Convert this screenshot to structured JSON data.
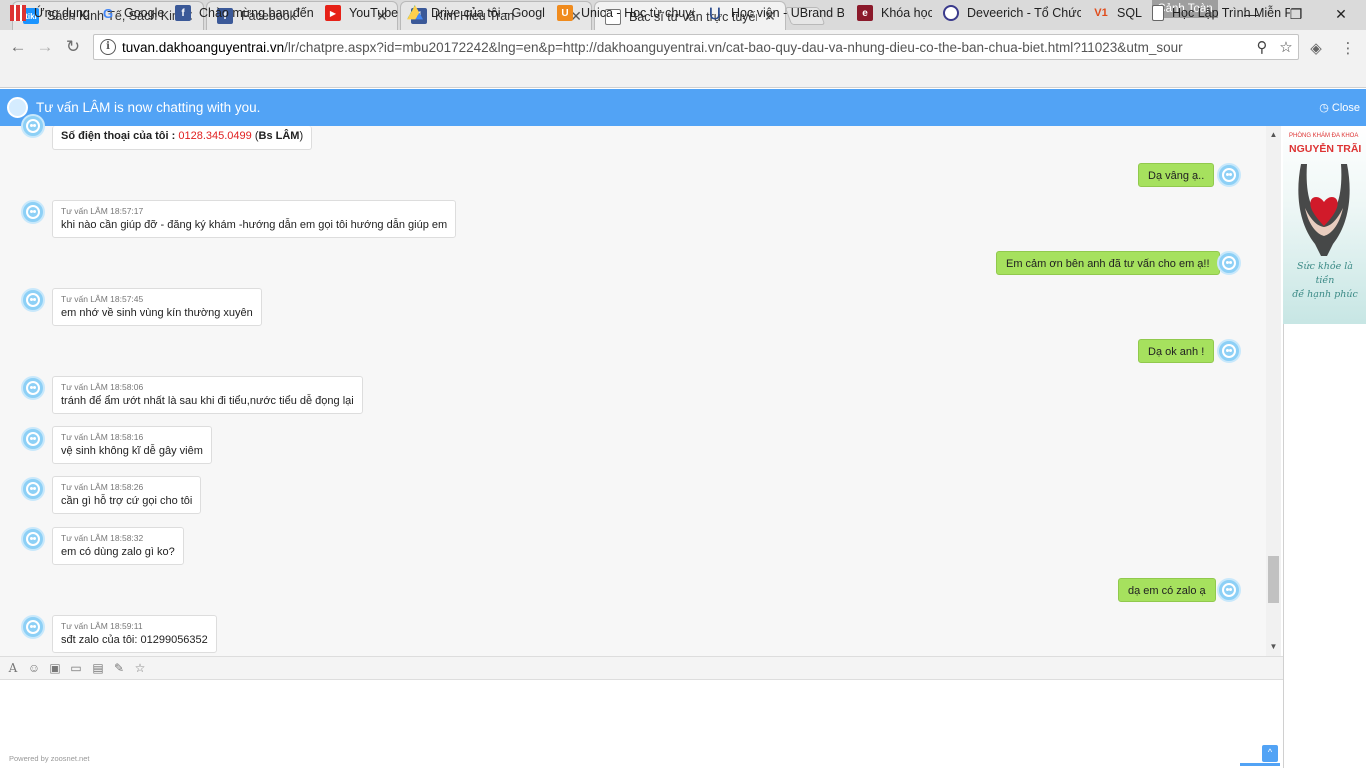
{
  "tabs": [
    {
      "title": "Sách Kinh Tế, Sách Kinh Doanh",
      "favicon": "tiki-icon",
      "color": "#1a94ff"
    },
    {
      "title": "Facebook",
      "favicon": "facebook-icon",
      "color": "#3b5998"
    },
    {
      "title": "Kim Hieu Tran",
      "favicon": "facebook-icon",
      "color": "#3b5998"
    },
    {
      "title": "Bác sĩ tư vấn trực tuyến",
      "favicon": "document-icon",
      "color": "#777777"
    }
  ],
  "tiki_label": "tiki",
  "profile_name": "Cảnh Toàn",
  "window": {
    "minimize": "—",
    "maximize": "❐",
    "close": "✕"
  },
  "address": {
    "host": "tuvan.dakhoanguyentrai.vn",
    "path": "/lr/chatpre.aspx?id=mbu20172242&lng=en&p=http://dakhoanguyentrai.vn/cat-bao-quy-dau-va-nhung-dieu-co-the-ban-chua-biet.html?11023&utm_sour"
  },
  "bookmarks": [
    {
      "label": "Ứng dụng",
      "icon": "apps-grid-icon"
    },
    {
      "label": "Google",
      "icon": "google-icon"
    },
    {
      "label": "Chào mừng bạn đến",
      "icon": "facebook-icon"
    },
    {
      "label": "YouTube",
      "icon": "youtube-icon"
    },
    {
      "label": "Drive của tôi - Google",
      "icon": "google-drive-icon"
    },
    {
      "label": "Unica - Học từ chuyên",
      "icon": "unica-icon"
    },
    {
      "label": "Học viện - UBrand Be",
      "icon": "ubrand-icon"
    },
    {
      "label": "Khóa học",
      "icon": "khoa-hoc-icon"
    },
    {
      "label": "Deveerich - Tổ Chức",
      "icon": "deveerich-icon"
    },
    {
      "label": "SQL",
      "icon": "v1-icon"
    },
    {
      "label": "Học Lập Trình Miễn Phí",
      "icon": "document-icon"
    }
  ],
  "bookmark_icon_text": {
    "google": "G",
    "facebook": "f",
    "unica": "U",
    "khoa": "e",
    "v1": "V1"
  },
  "chat": {
    "header_title": "Tư vấn LÂM is now chatting with you.",
    "close_label": "Close",
    "phone_label": "Số điện thoại của tôi : ",
    "phone_number": "0128.345.0499",
    "phone_suffix_open": " (",
    "phone_name": "Bs LÂM",
    "phone_suffix_close": ")",
    "outgoing": [
      "Dạ vâng ạ..",
      "Em cảm ơn bên anh đã tư vấn cho em ạ!!",
      "Dạ ok anh !",
      "dạ em có zalo ạ"
    ],
    "incoming": [
      {
        "meta": "Tư vấn LÂM 18:57:17",
        "text": "khi nào cần giúp đỡ - đăng ký khám -hướng dẫn  em gọi tôi hướng dẫn giúp em"
      },
      {
        "meta": "Tư vấn LÂM 18:57:45",
        "text": "em nhớ về sinh vùng kín thường xuyên"
      },
      {
        "meta": "Tư vấn LÂM 18:58:06",
        "text": "tránh để ẩm ướt nhất là sau khi đi tiểu,nước tiểu dễ đọng lại"
      },
      {
        "meta": "Tư vấn LÂM 18:58:16",
        "text": "vệ sinh không kĩ dễ gây viêm"
      },
      {
        "meta": "Tư vấn LÂM 18:58:26",
        "text": "cần gì hỗ trợ cứ gọi cho tôi"
      },
      {
        "meta": "Tư vấn LÂM 18:58:32",
        "text": "em có dùng zalo gì ko?"
      },
      {
        "meta": "Tư vấn LÂM 18:59:11",
        "text": "sđt zalo của tôi: 01299056352"
      }
    ],
    "powered_by": "Powered by zoosnet.net",
    "colors": {
      "header": "#52a3f5",
      "outgoing_bubble": "#a6e15e",
      "phone_number": "#e02020"
    }
  },
  "banner": {
    "small_text": "PHÒNG KHÁM ĐA KHOA",
    "big_text": "NGUYỄN TRÃI",
    "slogan_line1": "Sức khỏe là tiền",
    "slogan_line2": "đề hạnh phúc"
  }
}
